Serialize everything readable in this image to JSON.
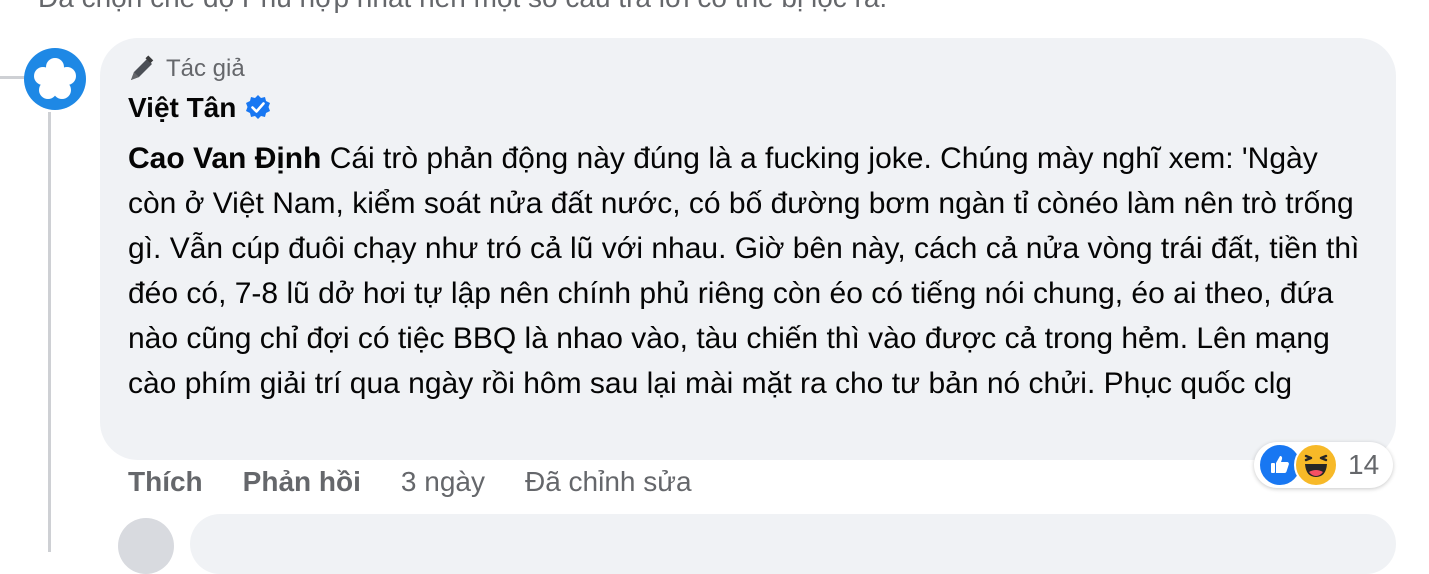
{
  "top_note": "Đã chọn chế độ Phù hợp nhất nên một số câu trả lời có thể bị lọc ra.",
  "comment": {
    "badge_icon": "pen-icon",
    "badge_label": "Tác giả",
    "author_name": "Việt Tân",
    "verified_icon": "verified-badge-icon",
    "mention": "Cao Van Định",
    "text": "Cái trò phản động này đúng là a fucking joke. Chúng mày nghĩ xem: 'Ngày còn ở Việt Nam, kiểm soát nửa đất nước, có bố đường bơm ngàn tỉ cònéo làm nên trò trống gì. Vẫn cúp đuôi chạy như tró cả lũ với nhau. Giờ bên này, cách cả nửa vòng trái đất, tiền thì đéo có, 7-8 lũ dở hơi tự lập nên chính phủ riêng còn éo có tiếng nói chung, éo ai theo, đứa nào cũng chỉ đợi có tiệc BBQ là nhao vào, tàu chiến thì vào được cả trong hẻm. Lên mạng cào phím giải trí qua ngày rồi hôm sau lại mài mặt ra cho tư bản nó chửi. Phục quốc clg",
    "reactions": {
      "icons": [
        "like-icon",
        "haha-icon"
      ],
      "count": "14",
      "like_color": "#1877f2",
      "haha_color": "#f7b928"
    },
    "actions": {
      "like": "Thích",
      "reply": "Phản hồi",
      "time": "3 ngày",
      "edited": "Đã chỉnh sửa"
    }
  },
  "colors": {
    "bubble": "#f0f2f5",
    "secondary_text": "#65676b",
    "verified": "#1877f2",
    "avatar": "#1e88e5"
  }
}
